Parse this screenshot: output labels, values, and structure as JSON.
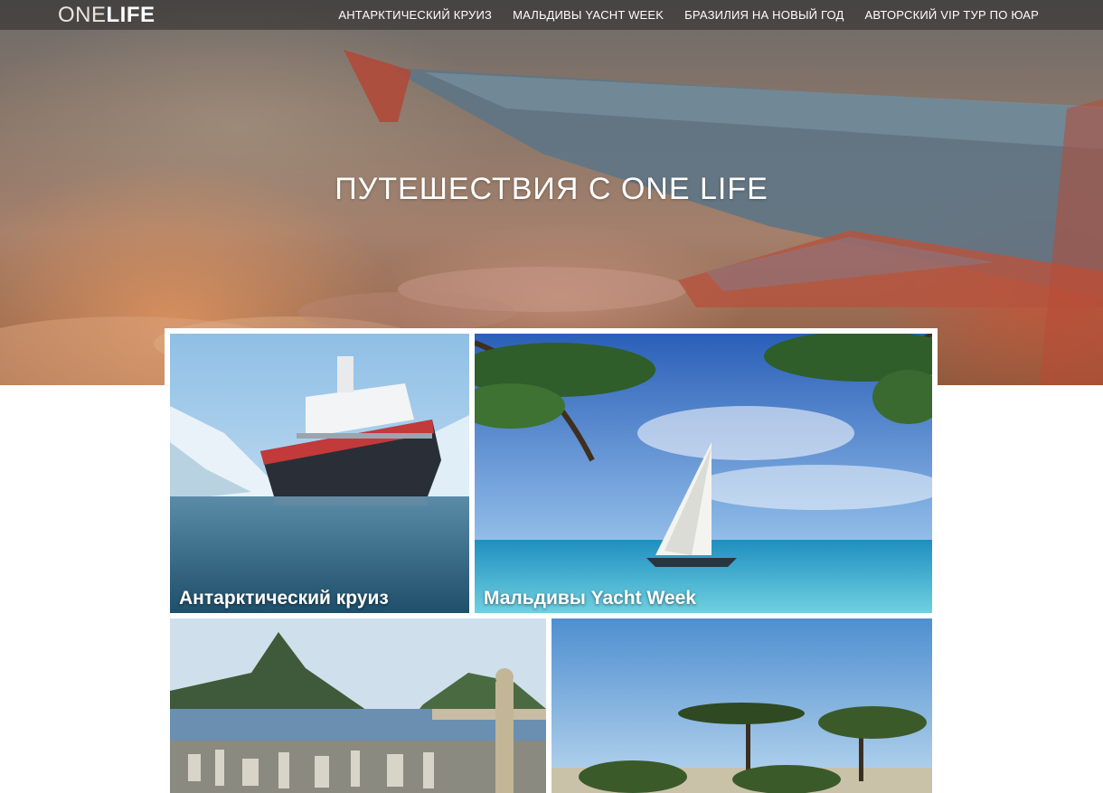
{
  "brand": {
    "logo_light": "ONE",
    "logo_bold": "LIFE"
  },
  "nav": {
    "items": [
      {
        "label": "АНТАРКТИЧЕСКИЙ КРУИЗ"
      },
      {
        "label": "МАЛЬДИВЫ YACHT WEEK"
      },
      {
        "label": "БРАЗИЛИЯ НА НОВЫЙ ГОД"
      },
      {
        "label": "АВТОРСКИЙ VIP ТУР ПО ЮАР"
      }
    ]
  },
  "hero": {
    "title": "ПУТЕШЕСТВИЯ С ONE LIFE"
  },
  "tours": [
    {
      "label": "Антарктический круиз",
      "image": "antarctic-cruise-ship"
    },
    {
      "label": "Мальдивы Yacht Week",
      "image": "maldives-sailboat-palms"
    },
    {
      "label": "",
      "image": "rio-de-janeiro-christ"
    },
    {
      "label": "",
      "image": "south-africa-savanna"
    }
  ],
  "colors": {
    "nav_bg": "#282624",
    "text_on_dark": "#ffffff",
    "page_bg": "#ffffff"
  }
}
